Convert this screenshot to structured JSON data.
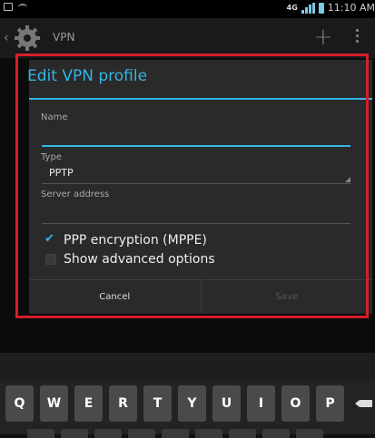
{
  "status_bar": {
    "network": "4G",
    "time": "11:10 AM"
  },
  "action_bar": {
    "title": "VPN",
    "add_symbol": "+",
    "icon": "gear-icon"
  },
  "dialog": {
    "title": "Edit VPN profile",
    "name_label": "Name",
    "name_value": "",
    "type_label": "Type",
    "type_value": "PPTP",
    "server_label": "Server address",
    "server_value": "",
    "ppp_encryption_label": "PPP encryption (MPPE)",
    "ppp_encryption_checked": true,
    "show_advanced_label": "Show advanced options",
    "show_advanced_checked": false,
    "cancel_label": "Cancel",
    "save_label": "Save"
  },
  "keyboard": {
    "row1": [
      "Q",
      "W",
      "E",
      "R",
      "T",
      "Y",
      "U",
      "I",
      "O",
      "P"
    ]
  },
  "colors": {
    "accent": "#33b5e5",
    "highlight_border": "#d21f2b"
  }
}
